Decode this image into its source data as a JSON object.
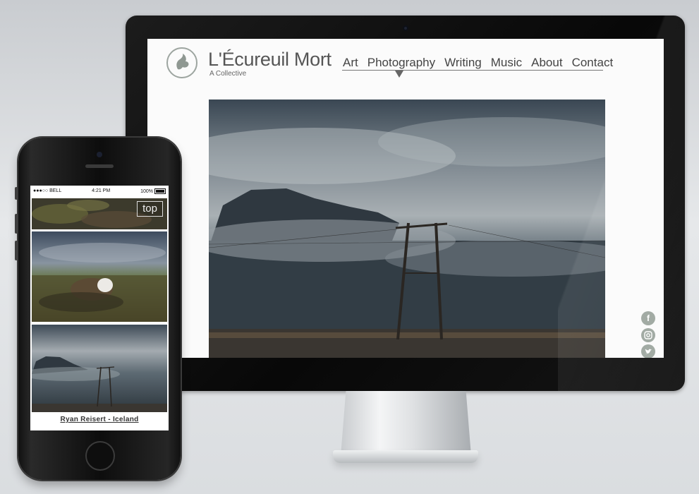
{
  "site": {
    "title": "L'Écureuil Mort",
    "tagline": "A Collective",
    "nav": [
      "Art",
      "Photography",
      "Writing",
      "Music",
      "About",
      "Contact"
    ],
    "active_nav": "Photography",
    "social": [
      "f",
      "instagram",
      "twitter"
    ]
  },
  "mobile": {
    "status": {
      "carrier": "●●●○○ BELL",
      "time": "4:21 PM",
      "battery": "100%"
    },
    "top_label": "top",
    "caption": "Ryan Reisert - Iceland"
  },
  "colors": {
    "accent": "#9da5a0",
    "screen_bg": "#fbfbfb",
    "text": "#444444"
  }
}
